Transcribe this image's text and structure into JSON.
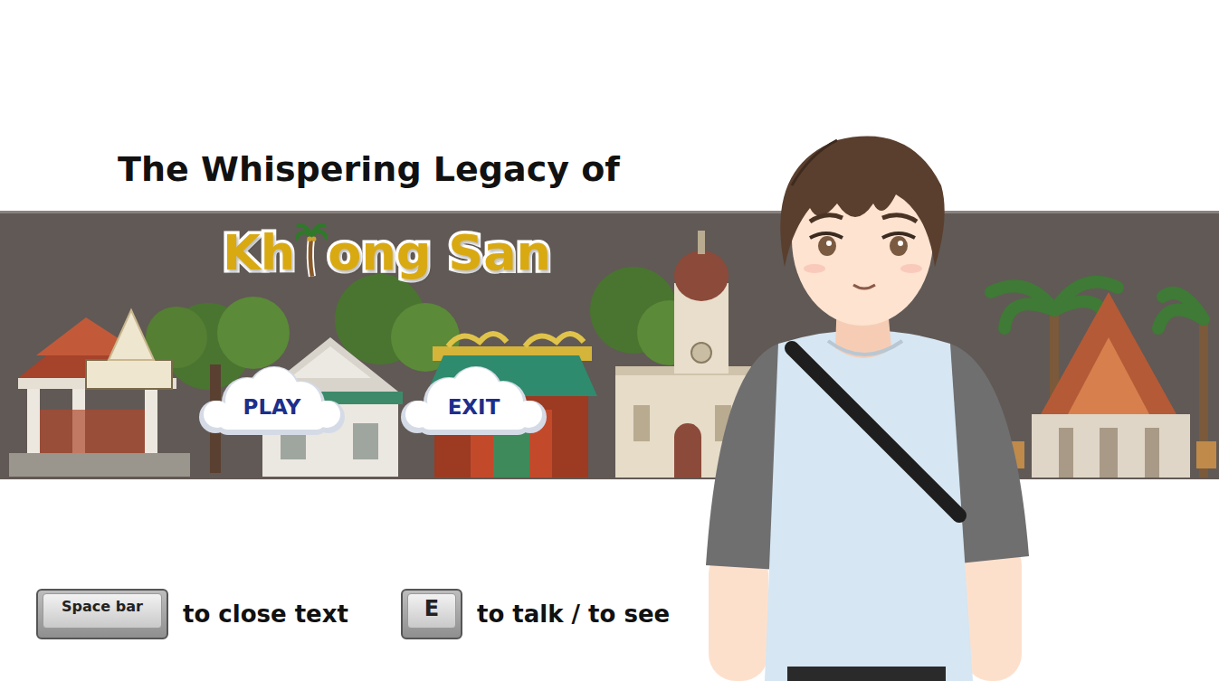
{
  "title": "The Whispering Legacy of",
  "logo": {
    "before": "Kh",
    "after": "ong San"
  },
  "menu": [
    {
      "label": "PLAY"
    },
    {
      "label": "EXIT"
    }
  ],
  "controls": [
    {
      "key": "Space bar",
      "action": "to close text",
      "kind": "wide"
    },
    {
      "key": "E",
      "action": "to talk / to see",
      "kind": "square"
    }
  ]
}
